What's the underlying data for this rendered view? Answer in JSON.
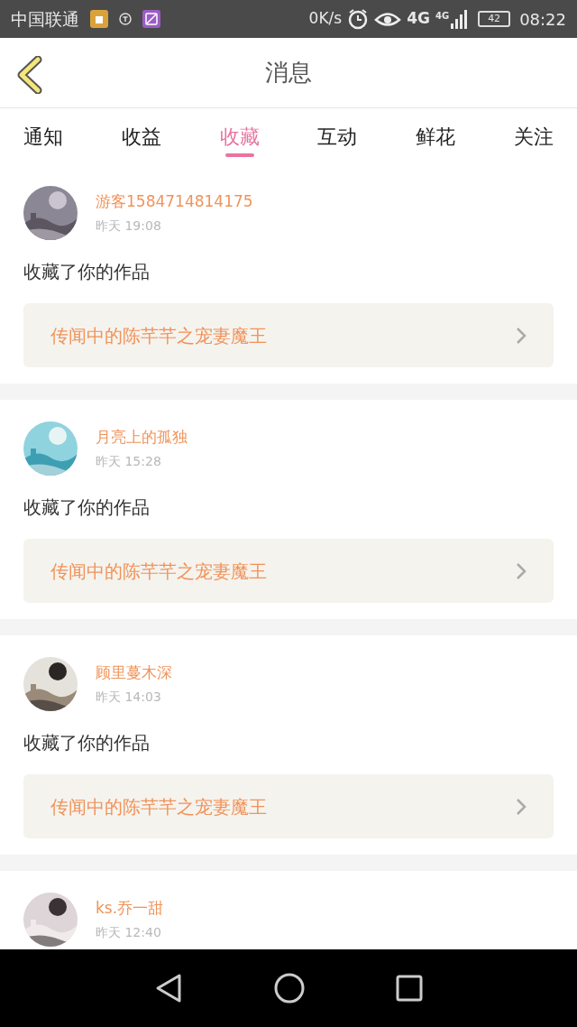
{
  "status_bar": {
    "carrier": "中国联通",
    "speed": "0K/s",
    "network": "4G",
    "signal_label": "4G",
    "battery": "42",
    "time": "08:22"
  },
  "header": {
    "title": "消息"
  },
  "tabs": [
    {
      "label": "通知",
      "selected": false
    },
    {
      "label": "收益",
      "selected": false
    },
    {
      "label": "收藏",
      "selected": true
    },
    {
      "label": "互动",
      "selected": false
    },
    {
      "label": "鲜花",
      "selected": false
    },
    {
      "label": "关注",
      "selected": false
    }
  ],
  "messages": [
    {
      "user": "游客1584714814175",
      "time": "昨天 19:08",
      "action": "收藏了你的作品",
      "work": "传闻中的陈芊芊之宠妻魔王"
    },
    {
      "user": "月亮上的孤独",
      "time": "昨天 15:28",
      "action": "收藏了你的作品",
      "work": "传闻中的陈芊芊之宠妻魔王"
    },
    {
      "user": "顾里蔓木深",
      "time": "昨天 14:03",
      "action": "收藏了你的作品",
      "work": "传闻中的陈芊芊之宠妻魔王"
    },
    {
      "user": "ks.乔一甜",
      "time": "昨天 12:40"
    }
  ]
}
